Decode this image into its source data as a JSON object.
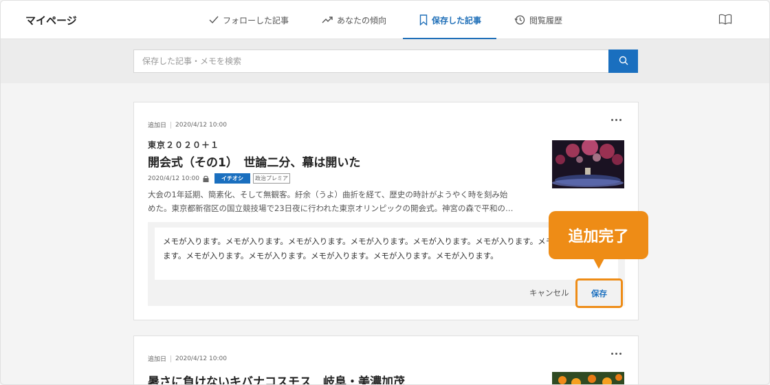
{
  "header": {
    "brand": "マイページ",
    "tabs": [
      {
        "label": "フォローした記事",
        "icon": "check-icon",
        "active": false
      },
      {
        "label": "あなたの傾向",
        "icon": "trend-icon",
        "active": false
      },
      {
        "label": "保存した記事",
        "icon": "bookmark-icon",
        "active": true
      },
      {
        "label": "閲覧履歴",
        "icon": "history-icon",
        "active": false
      }
    ],
    "right_icon": "book-icon"
  },
  "search": {
    "placeholder": "保存した記事・メモを検索",
    "button_icon": "search-icon"
  },
  "articles": [
    {
      "added_label": "追加日",
      "added_date": "2020/4/12 10:00",
      "series": "東京２０２０＋１",
      "title": "開会式（その1）　世論二分、幕は開いた",
      "published": "2020/4/12 10:00",
      "badge_primary": "イチオシ",
      "badge_secondary": "政治プレミア",
      "excerpt_line1": "大会の1年延期、簡素化、そして無観客。紆余（うよ）曲折を経て、歴史の時計がようやく時を刻み始",
      "excerpt_line2": "めた。東京都新宿区の国立競技場で23日夜に行われた東京オリンピックの開会式。神宮の森で平和の…",
      "memo_line1": "メモが入ります。メモが入ります。メモが入ります。メモが入ります。メモが入ります。メモが入ります。メモが入り",
      "memo_line2": "ます。メモが入ります。メモが入ります。メモが入ります。メモが入ります。メモが入ります。",
      "cancel_label": "キャンセル",
      "save_label": "保存"
    },
    {
      "added_label": "追加日",
      "added_date": "2020/4/12 10:00",
      "title": "暑さに負けないキバナコスモス　岐阜・美濃加茂"
    }
  ],
  "callout": {
    "text": "追加完了",
    "color": "#ee8c16"
  },
  "colors": {
    "accent": "#1a6fbf",
    "highlight": "#ee8c16"
  }
}
